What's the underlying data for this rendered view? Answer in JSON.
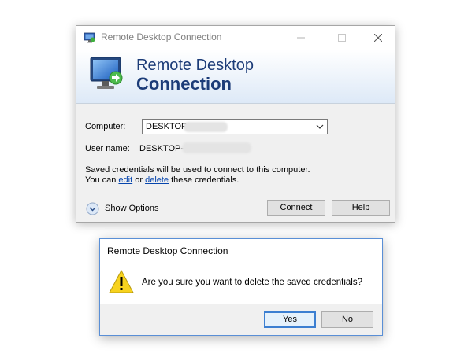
{
  "main_window": {
    "title": "Remote Desktop Connection",
    "banner_line1": "Remote Desktop",
    "banner_line2": "Connection",
    "computer_label": "Computer:",
    "computer_value": "DESKTOP-",
    "username_label": "User name:",
    "username_value": "DESKTOP-",
    "credentials_line1": "Saved credentials will be used to connect to this computer.",
    "credentials_prefix": "You can ",
    "edit_link": "edit",
    "or_text": " or ",
    "delete_link": "delete",
    "credentials_suffix": " these credentials.",
    "show_options_label": "Show Options",
    "connect_label": "Connect",
    "help_label": "Help"
  },
  "confirm_dialog": {
    "title": "Remote Desktop Connection",
    "message": "Are you sure you want to delete the saved credentials?",
    "yes_label": "Yes",
    "no_label": "No"
  },
  "colors": {
    "banner_text": "#1c3c78",
    "link": "#0645ad",
    "default_button_border": "#3c7fd1"
  },
  "icons": [
    "remote-desktop-app-icon",
    "minimize-icon",
    "maximize-icon",
    "close-icon",
    "remote-desktop-monitor-icon",
    "chevron-down-icon",
    "expand-options-icon",
    "warning-icon"
  ]
}
